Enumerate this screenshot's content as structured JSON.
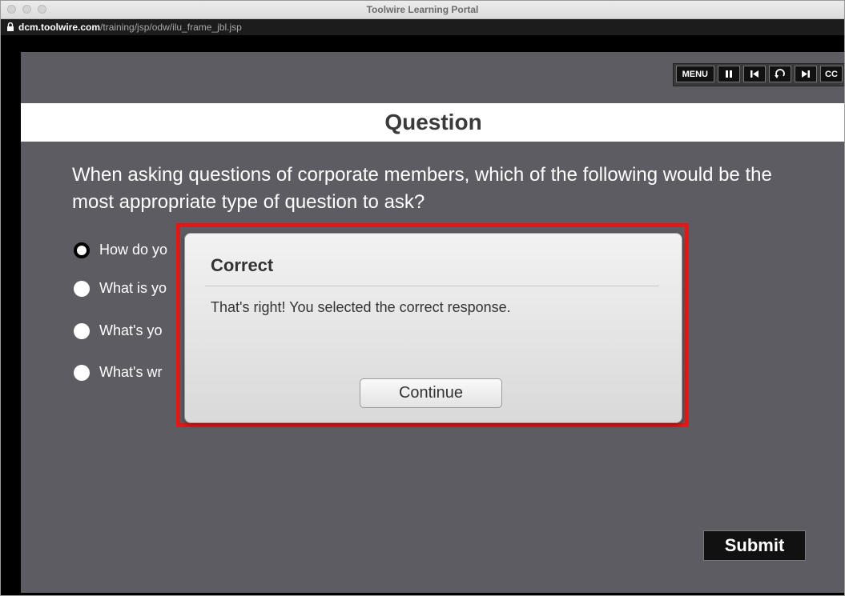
{
  "window": {
    "title": "Toolwire Learning Portal",
    "url_host": "dcm.toolwire.com",
    "url_path": "/training/jsp/odw/ilu_frame_jbl.jsp"
  },
  "player_controls": {
    "menu_label": "MENU",
    "pause_icon": "pause-icon",
    "prev_icon": "skip-back-icon",
    "replay_icon": "replay-icon",
    "next_icon": "skip-forward-icon",
    "cc_label": "CC"
  },
  "slide": {
    "banner_title": "Question",
    "question": "When asking questions of corporate members, which of the following would be the most appropriate type of question to ask?",
    "options": [
      {
        "label": "How do yo",
        "selected": true
      },
      {
        "label": "What is yo",
        "selected": false
      },
      {
        "label": "What's yo",
        "selected": false
      },
      {
        "label": "What's wr",
        "selected": false
      }
    ],
    "submit_label": "Submit"
  },
  "dialog": {
    "title": "Correct",
    "message": "That's right!  You selected the correct response.",
    "continue_label": "Continue"
  },
  "colors": {
    "highlight": "#e21818",
    "slide_background": "#5d5c63"
  }
}
